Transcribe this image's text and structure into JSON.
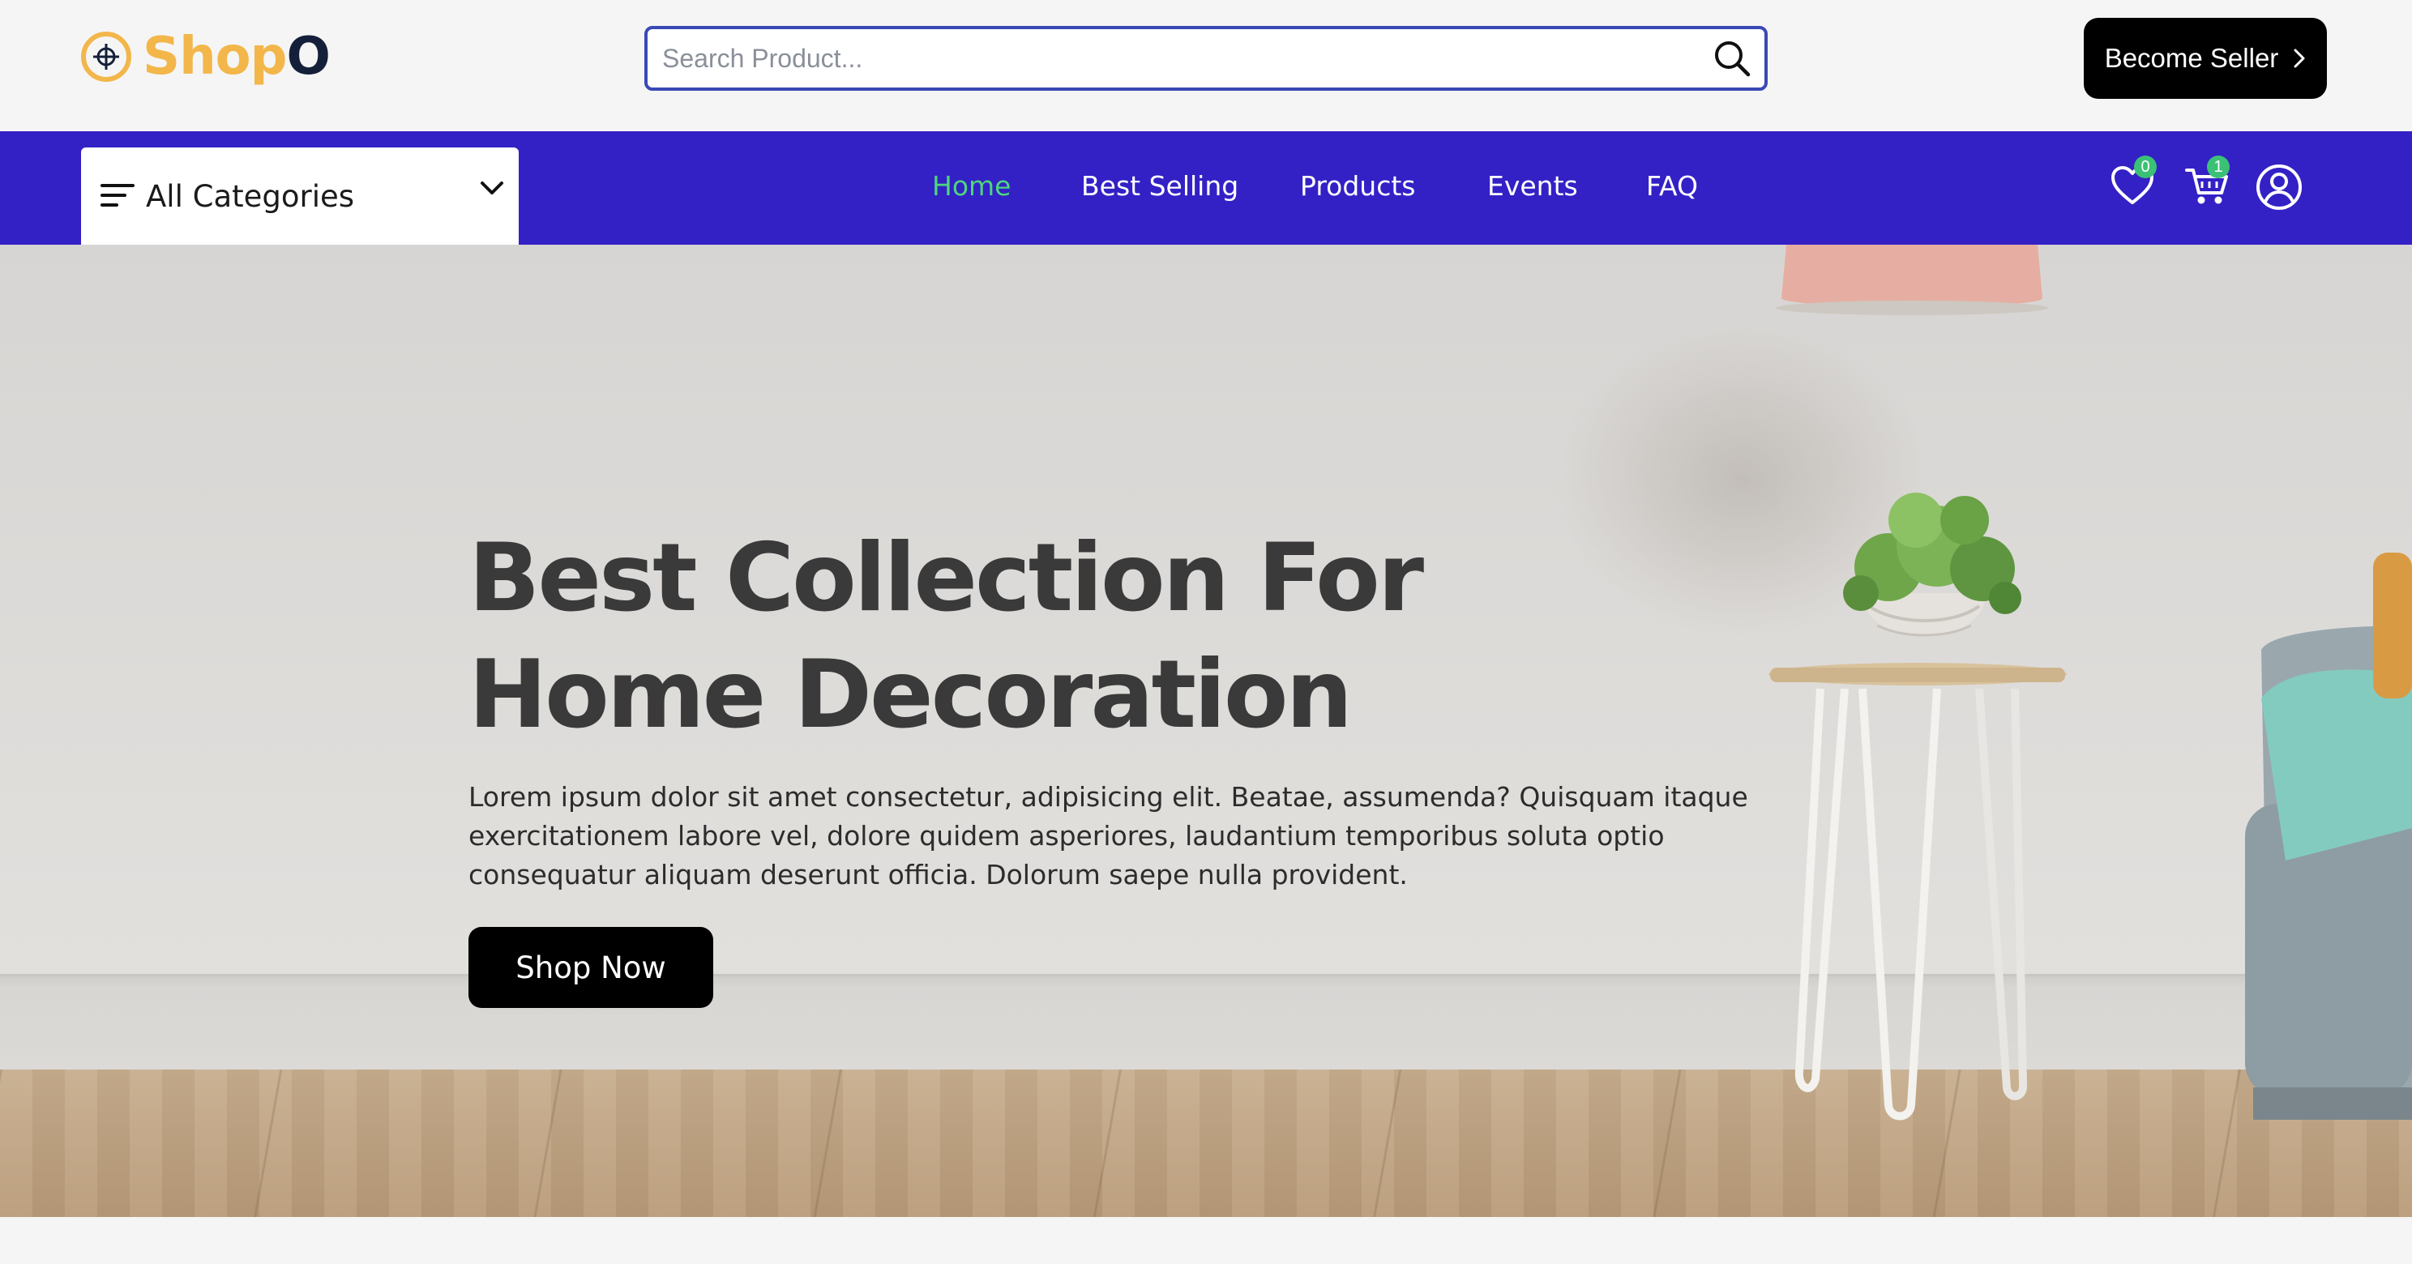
{
  "brand": {
    "name_part1": "Shop",
    "name_part2": "O"
  },
  "search": {
    "placeholder": "Search Product..."
  },
  "header": {
    "seller_button_label": "Become Seller"
  },
  "nav": {
    "categories_label": "All Categories",
    "links": [
      "Home",
      "Best Selling",
      "Products",
      "Events",
      "FAQ"
    ],
    "active_link": "Home",
    "wishlist_count": "0",
    "cart_count": "1"
  },
  "hero": {
    "title_line1": "Best Collection For",
    "title_line2": "Home Decoration",
    "description": "Lorem ipsum dolor sit amet consectetur, adipisicing elit. Beatae, assumenda? Quisquam itaque exercitationem labore vel, dolore quidem asperiores, laudantium temporibus soluta optio consequatur aliquam deserunt officia. Dolorum saepe nulla provident.",
    "cta_label": "Shop Now"
  },
  "icons": {
    "search": "search-icon",
    "seller_arrow": "chevron-right-icon",
    "categories": "menu-icon",
    "categories_dropdown": "chevron-down-icon",
    "wishlist": "heart-icon",
    "cart": "cart-icon",
    "profile": "user-circle-icon"
  },
  "colors": {
    "nav_background": "#3321c6",
    "active_link": "#4ed57d",
    "badge": "#3bc176",
    "brand_primary": "#f3b64a",
    "brand_secondary": "#14203a",
    "search_border": "#3a49b6"
  }
}
